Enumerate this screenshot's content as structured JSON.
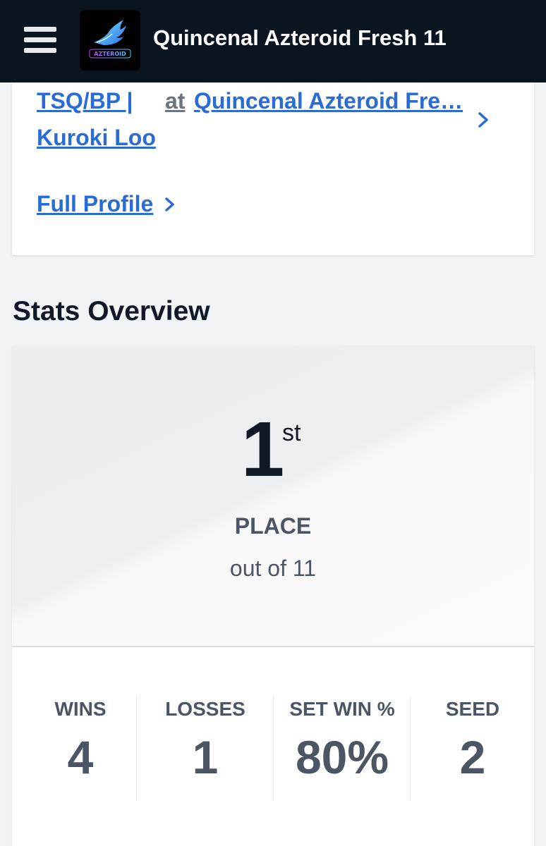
{
  "header": {
    "title": "Quincenal Azteroid Fresh 11",
    "logo_text": "AZTEROID"
  },
  "entrant": {
    "team_line1": "TSQ/BP |",
    "team_line2": "Kuroki Loo",
    "at_label": "at",
    "event_link": "Quincenal Azteroid Fre…",
    "full_profile": "Full Profile"
  },
  "stats": {
    "section_title": "Stats Overview",
    "place_number": "1",
    "place_suffix": "st",
    "place_label": "PLACE",
    "out_of": "out of 11",
    "items": [
      {
        "label": "WINS",
        "value": "4"
      },
      {
        "label": "LOSSES",
        "value": "1"
      },
      {
        "label": "SET WIN %",
        "value": "80%"
      },
      {
        "label": "SEED",
        "value": "2"
      }
    ]
  },
  "colors": {
    "topbar": "#0a1520",
    "link": "#2a6bd6",
    "text_dark": "#111827",
    "text_muted": "#4b5563"
  }
}
